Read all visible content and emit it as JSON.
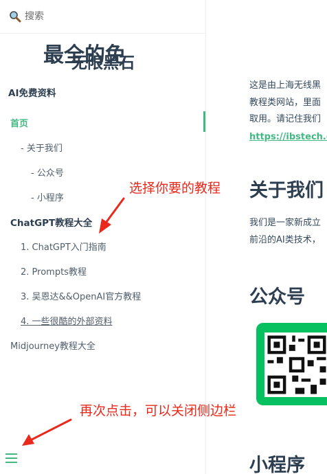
{
  "search": {
    "placeholder": "搜索"
  },
  "sidebar": {
    "app_name": "无限黑石",
    "items": [
      {
        "label": "AI免费资料"
      },
      {
        "label": "首页"
      },
      {
        "label": "- 关于我们"
      },
      {
        "label": "- 公众号"
      },
      {
        "label": "- 小程序"
      },
      {
        "label": "ChatGPT教程大全"
      },
      {
        "label": "1. ChatGPT入门指南"
      },
      {
        "label": "2. Prompts教程"
      },
      {
        "label": "3. 吴恩达&&OpenAI官方教程"
      },
      {
        "label": "4. 一些很酷的外部资料"
      },
      {
        "label": "Midjourney教程大全"
      }
    ]
  },
  "annotations": {
    "choose_tutorial": "选择你要的教程",
    "close_sidebar": "再次点击，可以关闭侧边栏"
  },
  "content": {
    "title": "最全的免",
    "intro_lines": [
      "这是由上海无线黑",
      "教程类网站，里面",
      "取用。请记住我们"
    ],
    "link": "https://ibstech.cn",
    "about_heading": "关于我们",
    "about_lines": [
      "我们是一家新成立",
      "前沿的AI类技术，"
    ],
    "wechat_heading": "公众号",
    "miniprogram_heading": "小程序"
  },
  "colors": {
    "accent": "#42b983",
    "annotation": "#e8291c",
    "wechat_green": "#07c160"
  },
  "icons": {
    "search": "search-icon",
    "menu": "hamburger-icon"
  }
}
